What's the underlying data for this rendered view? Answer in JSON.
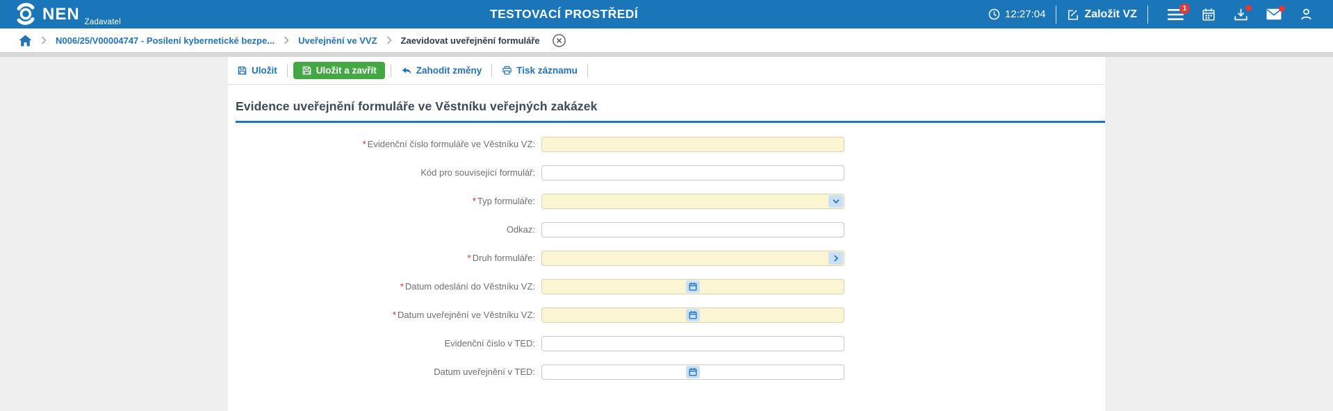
{
  "topbar": {
    "brand": "NEN",
    "brand_subtitle": "Zadavatel",
    "environment_label": "TESTOVACÍ PROSTŘEDÍ",
    "clock_time": "12:27:04",
    "create_button_label": "Založit VZ",
    "menu_badge_count": "1"
  },
  "breadcrumb": {
    "items": [
      "N006/25/V00004747 - Posílení kybernetické bezpe...",
      "Uveřejnění ve VVZ",
      "Zaevidovat uveřejnění formuláře"
    ]
  },
  "toolbar": {
    "save": "Uložit",
    "save_and_close": "Uložit a zavřít",
    "discard": "Zahodit změny",
    "print": "Tisk záznamu"
  },
  "form": {
    "title": "Evidence uveřejnění formuláře ve Věstníku veřejných zakázek",
    "fields": [
      {
        "label": "Evidenční číslo formuláře ve Věstníku VZ:",
        "required": true,
        "type": "text",
        "value": ""
      },
      {
        "label": "Kód pro související formulář:",
        "required": false,
        "type": "text",
        "value": ""
      },
      {
        "label": "Typ formuláře:",
        "required": true,
        "type": "select",
        "value": ""
      },
      {
        "label": "Odkaz:",
        "required": false,
        "type": "text",
        "value": ""
      },
      {
        "label": "Druh formuláře:",
        "required": true,
        "type": "picker",
        "value": ""
      },
      {
        "label": "Datum odeslání do Věstníku VZ:",
        "required": true,
        "type": "date",
        "value": ""
      },
      {
        "label": "Datum uveřejnění ve Věstníku VZ:",
        "required": true,
        "type": "date",
        "value": ""
      },
      {
        "label": "Evidenční číslo v TED:",
        "required": false,
        "type": "text",
        "value": ""
      },
      {
        "label": "Datum uveřejnění v TED:",
        "required": false,
        "type": "date",
        "value": ""
      }
    ]
  },
  "colors": {
    "topbar_blue": "#1b76b9",
    "accent_blue": "#2373b9",
    "green_button": "#43a843",
    "required_field_yellow": "#fbf5d3",
    "badge_red": "#e53935"
  }
}
